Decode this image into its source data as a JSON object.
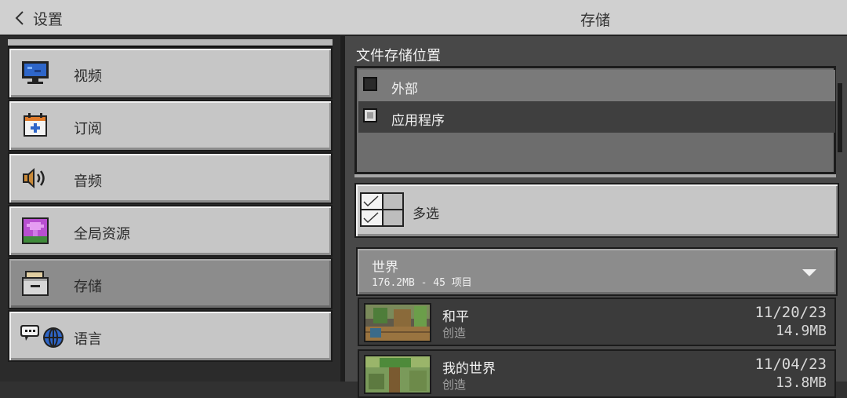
{
  "header": {
    "back_label": "设置",
    "title": "存储"
  },
  "sidebar": {
    "items": [
      {
        "label": "视频",
        "icon": "monitor-icon"
      },
      {
        "label": "订阅",
        "icon": "calendar-plus-icon"
      },
      {
        "label": "音频",
        "icon": "speaker-icon"
      },
      {
        "label": "全局资源",
        "icon": "global-resources-icon"
      },
      {
        "label": "存储",
        "icon": "storage-drawer-icon",
        "active": true
      },
      {
        "label": "语言",
        "icon": "language-globe-icon"
      }
    ]
  },
  "storage": {
    "section_title": "文件存储位置",
    "options": [
      {
        "label": "外部",
        "checked": false
      },
      {
        "label": "应用程序",
        "checked": true
      }
    ],
    "multi_select_label": "多选",
    "worlds": {
      "title": "世界",
      "summary": "176.2MB - 45 项目"
    },
    "world_list": [
      {
        "name": "和平",
        "type": "创造",
        "date": "11/20/23",
        "size": "14.9MB"
      },
      {
        "name": "我的世界",
        "type": "创造",
        "date": "11/04/23",
        "size": "13.8MB"
      }
    ]
  },
  "colors": {
    "button_light": "#c6c6c6",
    "button_active": "#8c8c8c",
    "panel_dark": "#484848",
    "topbar": "#d0d0d0"
  }
}
